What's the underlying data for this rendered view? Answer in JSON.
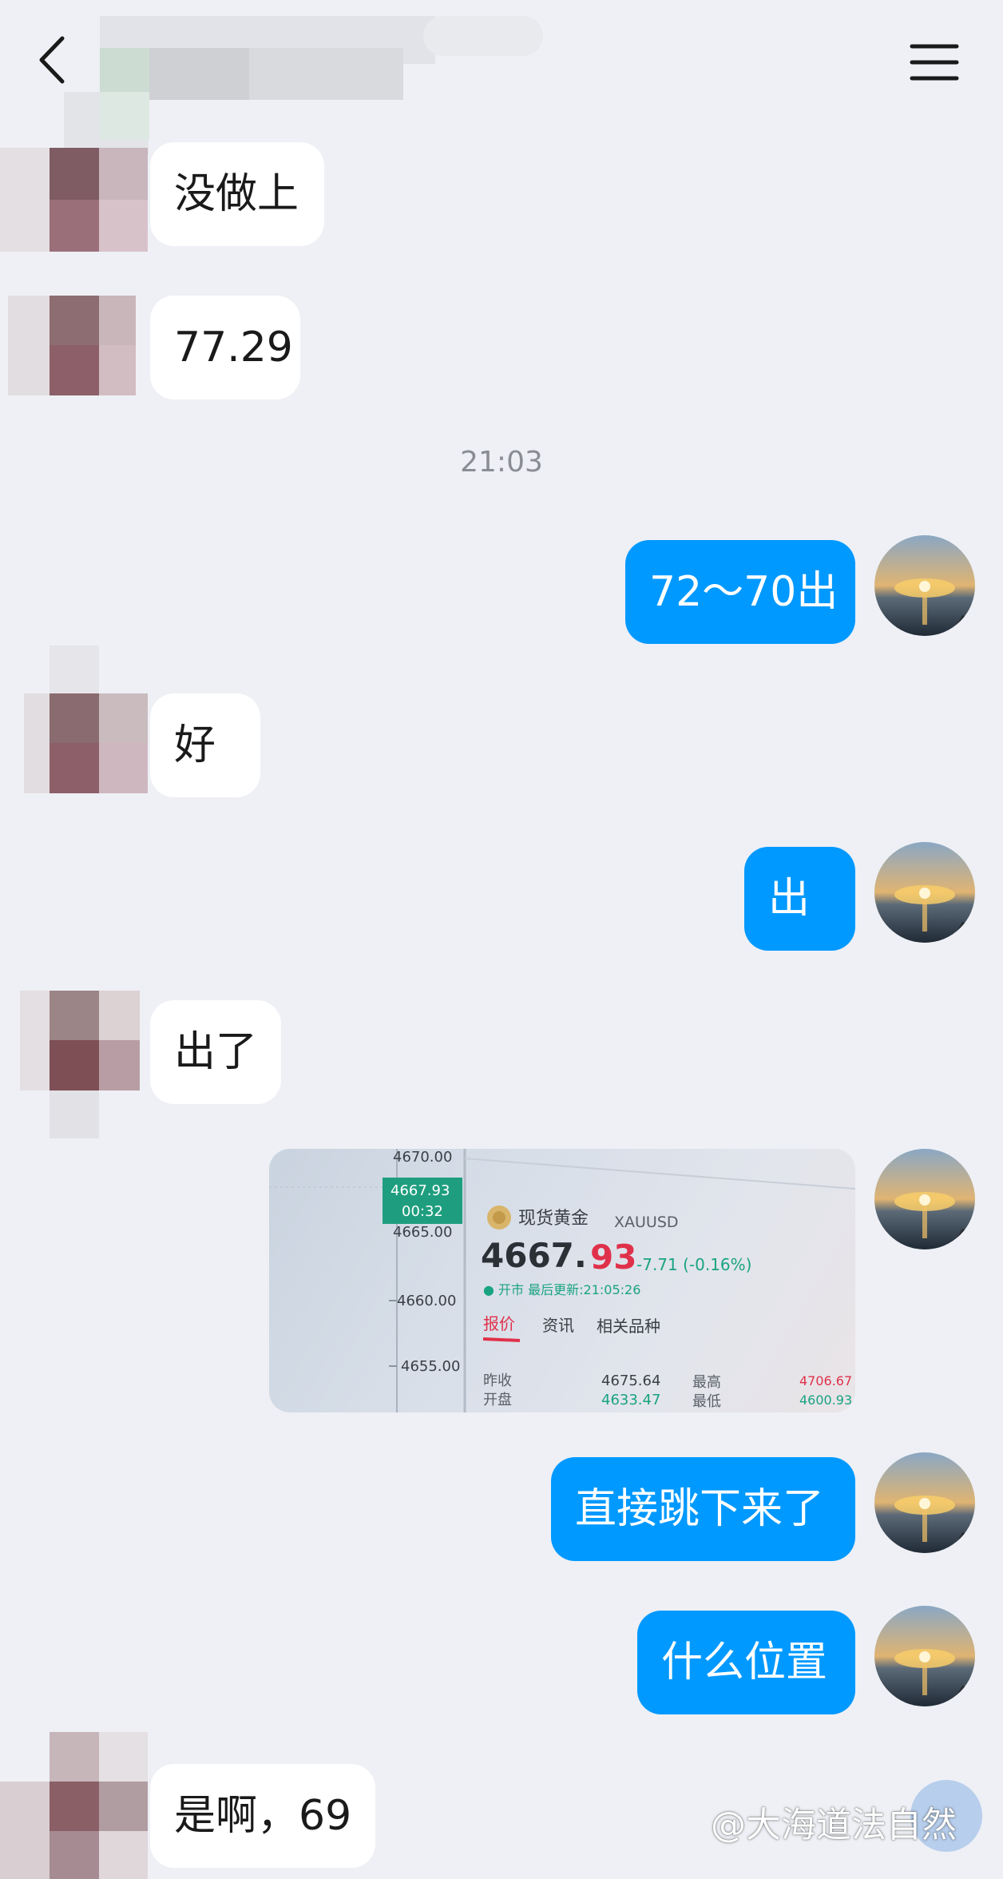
{
  "header": {
    "back_icon": "chevron-left-icon",
    "menu_icon": "hamburger-menu-icon"
  },
  "messages": [
    {
      "side": "in",
      "text": "没做上"
    },
    {
      "side": "in",
      "text": "77.29"
    },
    {
      "side": "time",
      "text": "21:03"
    },
    {
      "side": "out",
      "text": "72～70出"
    },
    {
      "side": "in",
      "text": "好"
    },
    {
      "side": "out",
      "text": "出"
    },
    {
      "side": "in",
      "text": "出了"
    },
    {
      "side": "out",
      "type": "image"
    },
    {
      "side": "out",
      "text": "直接跳下来了"
    },
    {
      "side": "out",
      "text": "什么位置"
    },
    {
      "side": "in",
      "text": "是啊，69"
    }
  ],
  "image_message": {
    "axis_prices": [
      "4670.00",
      "4665.00",
      "4660.00",
      "4655.00"
    ],
    "current_tag_price": "4667.93",
    "current_tag_time": "00:32",
    "instrument_name": "现货黄金",
    "instrument_code": "XAUUSD",
    "price_main": "4667.",
    "price_decimal": "93",
    "change": "-7.71 (-0.16%)",
    "status": "● 开市 最后更新:21:05:26",
    "tabs": [
      "报价",
      "资讯",
      "相关品种"
    ],
    "rows": [
      {
        "label": "昨收",
        "value": "4675.64",
        "label2": "最高",
        "value2": "4706.67"
      },
      {
        "label": "开盘",
        "value": "4633.47",
        "label2": "最低",
        "value2": "4600.93"
      }
    ]
  },
  "watermark": "@大海道法自然",
  "colors": {
    "background": "#eef0f5",
    "outgoing_bubble": "#0099ff",
    "incoming_bubble": "#ffffff",
    "timestamp": "#8a8d93",
    "price_red": "#e0314a",
    "change_green": "#1aa383",
    "tag_green": "#1e9e7e"
  }
}
